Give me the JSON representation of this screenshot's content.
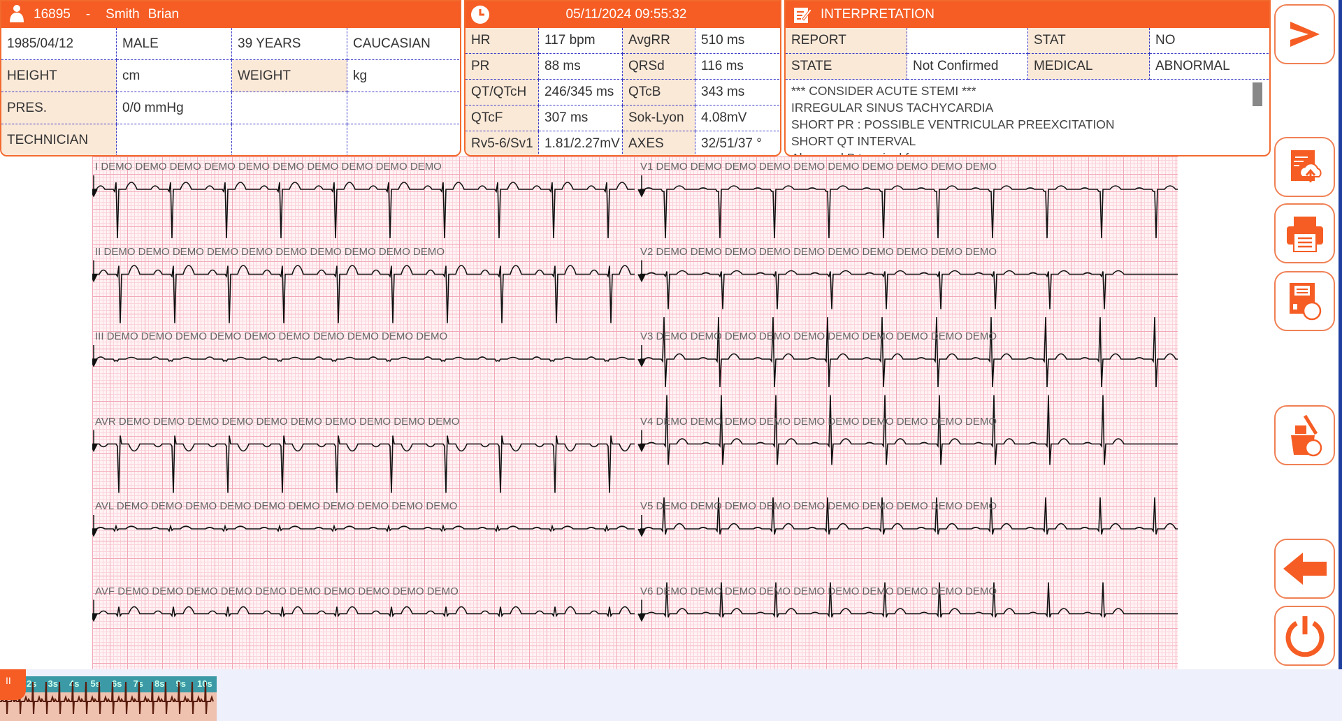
{
  "patient": {
    "id": "16895",
    "separator": "-",
    "last_name": "Smith",
    "first_name": "Brian",
    "id_badge": "ID",
    "rows": [
      [
        {
          "t": "1985/04/12",
          "l": false
        },
        {
          "t": "MALE",
          "l": false
        },
        {
          "t": "39 YEARS",
          "l": false
        },
        {
          "t": "CAUCASIAN",
          "l": false
        }
      ],
      [
        {
          "t": "HEIGHT",
          "l": true
        },
        {
          "t": " cm",
          "l": false
        },
        {
          "t": "WEIGHT",
          "l": true
        },
        {
          "t": "kg",
          "l": false
        }
      ],
      [
        {
          "t": "PRES.",
          "l": true
        },
        {
          "t": "0/0 mmHg",
          "l": false
        },
        {
          "t": "",
          "l": false
        },
        {
          "t": "",
          "l": false
        }
      ],
      [
        {
          "t": "TECHNICIAN",
          "l": true
        },
        {
          "t": "",
          "l": false
        },
        {
          "t": "",
          "l": false
        },
        {
          "t": "",
          "l": false
        }
      ]
    ]
  },
  "measurements": {
    "datetime": "05/11/2024 09:55:32",
    "rows": [
      [
        "HR",
        "117 bpm",
        "AvgRR",
        "510 ms"
      ],
      [
        "PR",
        "88 ms",
        "QRSd",
        "116 ms"
      ],
      [
        "QT/QTcH",
        "246/345 ms",
        "QTcB",
        "343 ms"
      ],
      [
        "QTcF",
        "307 ms",
        "Sok-Lyon",
        "4.08mV"
      ],
      [
        "Rv5-6/Sv1",
        "1.81/2.27mV",
        "AXES",
        "32/51/37 °"
      ]
    ]
  },
  "interpretation": {
    "title": "INTERPRETATION",
    "rows": [
      [
        "REPORT",
        "",
        "STAT",
        "NO"
      ],
      [
        "STATE",
        "Not Confirmed",
        "MEDICAL",
        "ABNORMAL"
      ]
    ],
    "lines": [
      "*** CONSIDER ACUTE STEMI ***",
      "IRREGULAR SINUS TACHYCARDIA",
      "SHORT PR : POSSIBLE VENTRICULAR PREEXCITATION",
      "SHORT QT INTERVAL",
      "Abnormal P terminal force"
    ]
  },
  "ecg": {
    "watermark": "DEMO DEMO DEMO DEMO DEMO DEMO DEMO DEMO DEMO DEMO",
    "left_leads": [
      "I",
      "II",
      "III",
      "AVR",
      "AVL",
      "AVF"
    ],
    "right_leads": [
      "V1",
      "V2",
      "V3",
      "V4",
      "V5",
      "V6"
    ]
  },
  "sidebar": {
    "buttons": [
      "next",
      "export-cloud",
      "print",
      "save",
      "delete",
      "back",
      "power"
    ]
  },
  "bottom": {
    "pause_label": "II",
    "time_marks": [
      "2s",
      "3s",
      "4s",
      "5s",
      "6s",
      "7s",
      "8s",
      "9s",
      "10s"
    ]
  },
  "colors": {
    "accent": "#f55d24",
    "label_bg": "#fbe9d8",
    "grid": "#f3a8b6"
  }
}
